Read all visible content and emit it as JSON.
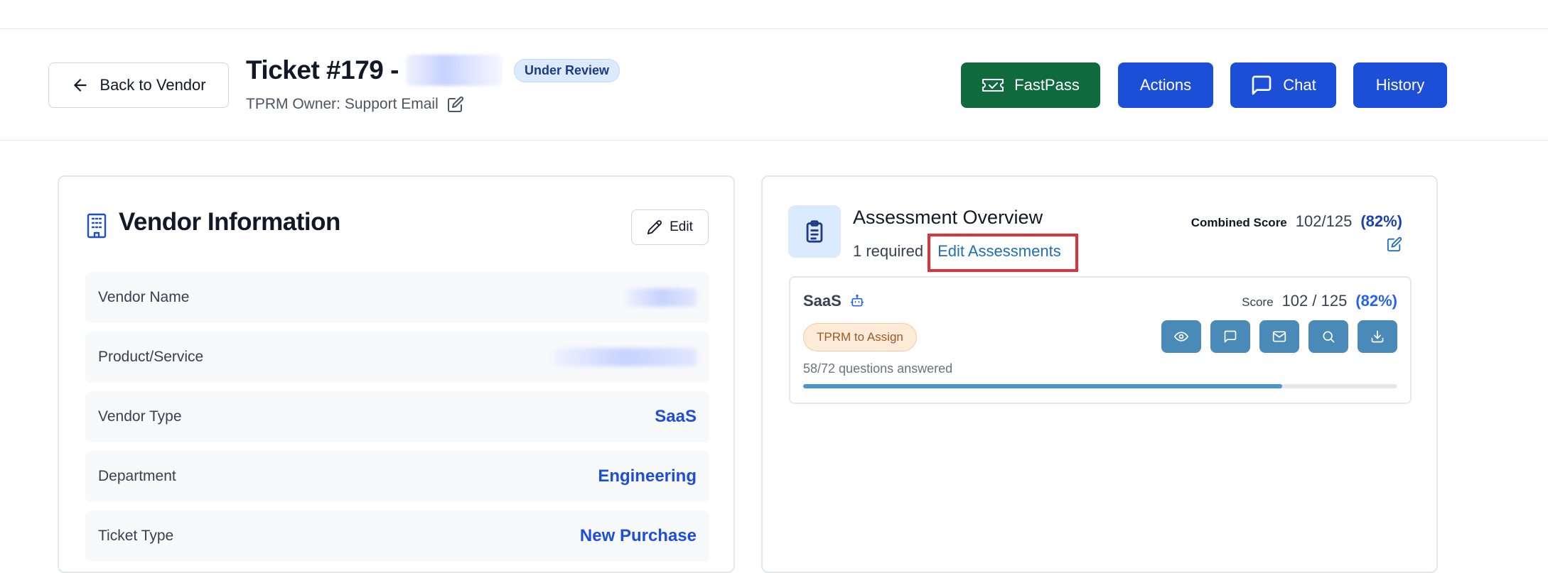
{
  "header": {
    "back_label": "Back to Vendor",
    "ticket_title": "Ticket #179 -",
    "status_badge": "Under Review",
    "owner_label": "TPRM Owner: Support Email",
    "buttons": {
      "fastpass": "FastPass",
      "actions": "Actions",
      "chat": "Chat",
      "history": "History"
    }
  },
  "vendor_info": {
    "title": "Vendor Information",
    "edit_label": "Edit",
    "rows": [
      {
        "label": "Vendor Name",
        "value": ""
      },
      {
        "label": "Product/Service",
        "value": ""
      },
      {
        "label": "Vendor Type",
        "value": "SaaS"
      },
      {
        "label": "Department",
        "value": "Engineering"
      },
      {
        "label": "Ticket Type",
        "value": "New Purchase"
      }
    ]
  },
  "assessment_overview": {
    "title": "Assessment Overview",
    "required_text": "1 required",
    "edit_link": "Edit Assessments",
    "combined_label": "Combined Score",
    "combined_value": "102/125",
    "combined_percent": "(82%)",
    "assessment": {
      "name": "SaaS",
      "score_label": "Score",
      "score_value": "102 / 125",
      "score_percent": "(82%)",
      "badge": "TPRM to Assign",
      "progress_text": "58/72 questions answered",
      "progress_fraction": 0.806
    }
  },
  "colors": {
    "primary": "#1d4ed8",
    "fastpass": "#0f6a3e",
    "highlight": "#e0303a",
    "icon_button": "#4a8ab8"
  }
}
